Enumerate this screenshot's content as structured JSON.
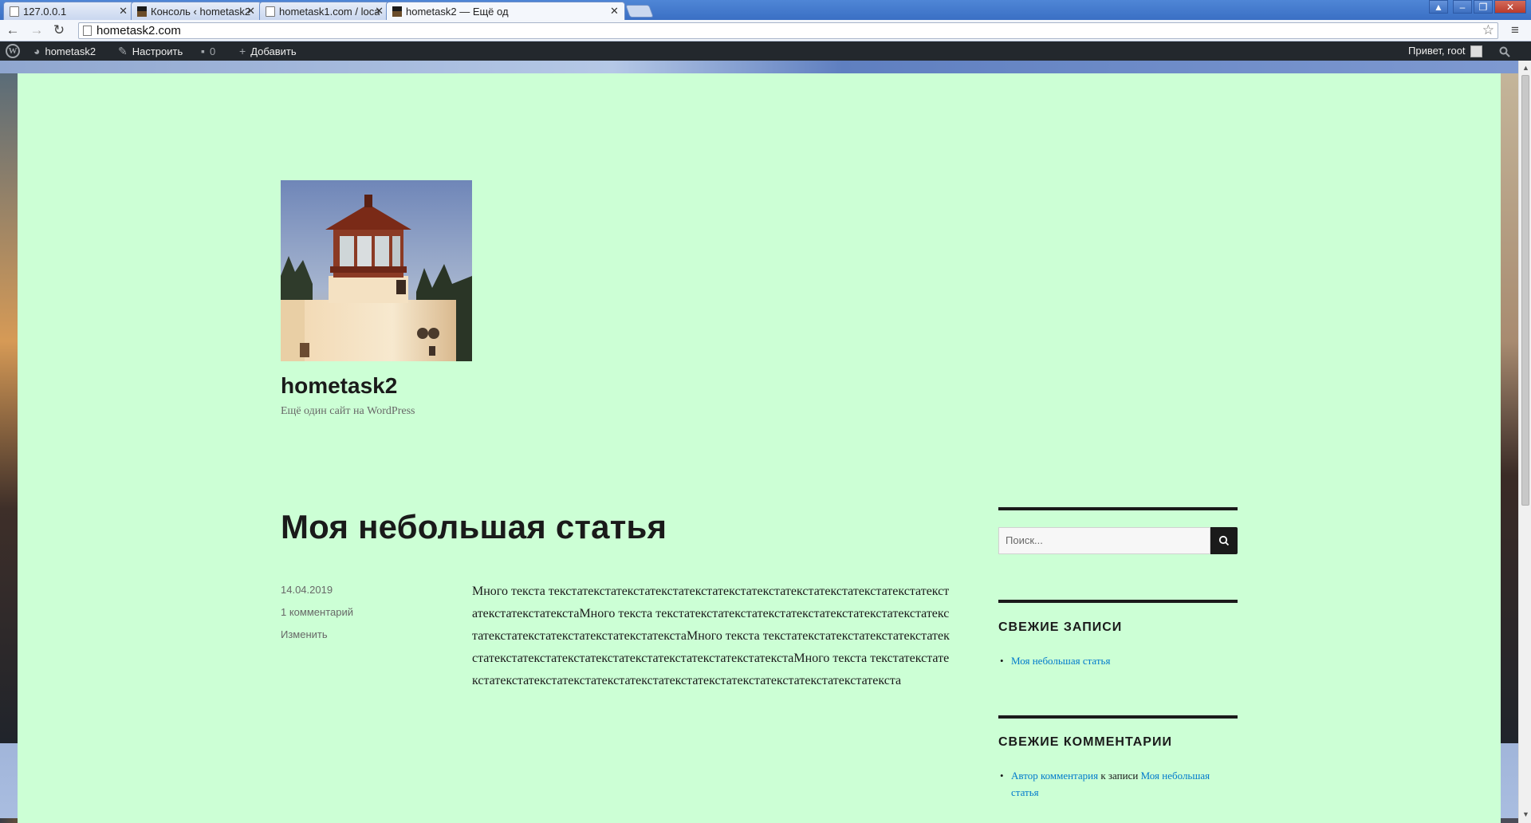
{
  "browser": {
    "tabs": [
      {
        "title": "127.0.0.1",
        "active": false
      },
      {
        "title": "Консоль ‹ hometask2",
        "active": false
      },
      {
        "title": "hometask1.com / loca",
        "active": false
      },
      {
        "title": "hometask2 — Ещё од",
        "active": true
      }
    ],
    "url": "hometask2.com"
  },
  "adminbar": {
    "site_name": "hometask2",
    "customize": "Настроить",
    "comments_count": "0",
    "add_new": "Добавить",
    "greeting": "Привет, root"
  },
  "site": {
    "title": "hometask2",
    "description": "Ещё один сайт на WordPress"
  },
  "post": {
    "title": "Моя небольшая статья",
    "date": "14.04.2019",
    "comments": "1 комментарий",
    "edit": "Изменить",
    "body": "Много текста текстатекстатекстатекстатекстатекстатекстатекстатекстатекстатекстатекстатекстатекстатекстаМного текста текстатекстатекстатекстатекстатекстатекстатекстатекстатекстатекстатекстатекстатекстатекстаМного текста текстатекстатекстатекстатекстатекстатекстатекстатекстатекстатекстатекстатекстатекстатекстаМного текста текстатекстатекстатекстатекстатекстатекстатекстатекстатекстатекстатекстатекстатекстатекста"
  },
  "sidebar": {
    "search_placeholder": "Поиск...",
    "recent_posts_title": "СВЕЖИЕ ЗАПИСИ",
    "recent_posts": [
      "Моя небольшая статья"
    ],
    "recent_comments_title": "СВЕЖИЕ КОММЕНТАРИИ",
    "recent_comment": {
      "author": "Автор комментария",
      "connector": "к записи",
      "post": "Моя небольшая статья"
    }
  }
}
